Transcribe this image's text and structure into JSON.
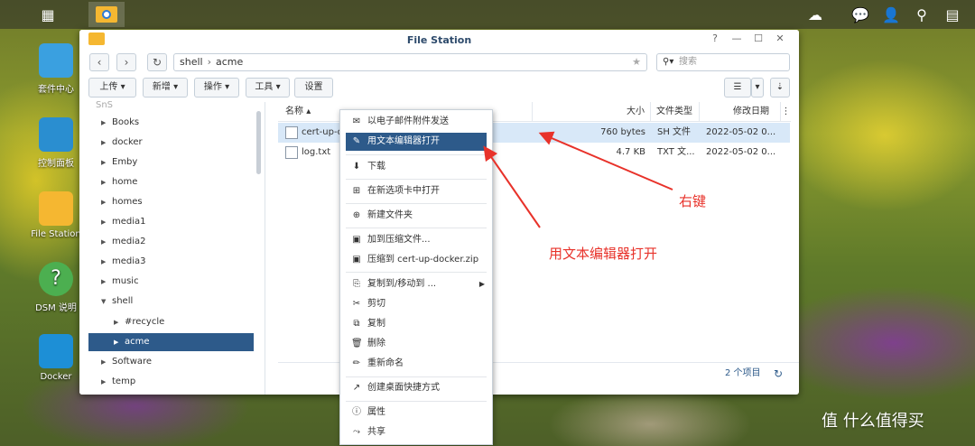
{
  "window": {
    "title": "File Station"
  },
  "desktop_icons": [
    {
      "label": "套件中心"
    },
    {
      "label": "控制面板"
    },
    {
      "label": "File Station"
    },
    {
      "label": "DSM 说明"
    },
    {
      "label": "Docker"
    }
  ],
  "path": {
    "segments": [
      "shell",
      "acme"
    ]
  },
  "search": {
    "placeholder": "搜索"
  },
  "toolbar": {
    "upload": "上传",
    "new": "新增",
    "action": "操作",
    "tools": "工具",
    "settings": "设置"
  },
  "tree": {
    "root": "SnS",
    "items": [
      {
        "label": "Books"
      },
      {
        "label": "docker"
      },
      {
        "label": "Emby"
      },
      {
        "label": "home"
      },
      {
        "label": "homes"
      },
      {
        "label": "media1"
      },
      {
        "label": "media2"
      },
      {
        "label": "media3"
      },
      {
        "label": "music"
      },
      {
        "label": "shell"
      },
      {
        "label": "#recycle"
      },
      {
        "label": "acme"
      },
      {
        "label": "Software"
      },
      {
        "label": "temp"
      }
    ]
  },
  "columns": {
    "name": "名称",
    "size": "大小",
    "type": "文件类型",
    "modified": "修改日期"
  },
  "files": [
    {
      "name": "cert-up-d",
      "size": "760 bytes",
      "type": "SH 文件",
      "modified": "2022-05-02 0..."
    },
    {
      "name": "log.txt",
      "size": "4.7 KB",
      "type": "TXT 文...",
      "modified": "2022-05-02 0..."
    }
  ],
  "footer": {
    "count": "2 个项目"
  },
  "context_menu": {
    "items": [
      {
        "label": "以电子邮件附件发送",
        "icon": "mail-icon"
      },
      {
        "label": "用文本编辑器打开",
        "icon": "edit-icon"
      },
      {
        "label": "下载",
        "icon": "download-icon"
      },
      {
        "label": "在新选项卡中打开",
        "icon": "new-tab-icon"
      },
      {
        "label": "新建文件夹",
        "icon": "new-folder-icon"
      },
      {
        "label": "加到压缩文件...",
        "icon": "archive-icon"
      },
      {
        "label": "压缩到 cert-up-docker.zip",
        "icon": "zip-icon"
      },
      {
        "label": "复制到/移动到 ...",
        "icon": "copy-move-icon"
      },
      {
        "label": "剪切",
        "icon": "cut-icon"
      },
      {
        "label": "复制",
        "icon": "copy-icon"
      },
      {
        "label": "删除",
        "icon": "delete-icon"
      },
      {
        "label": "重新命名",
        "icon": "rename-icon"
      },
      {
        "label": "创建桌面快捷方式",
        "icon": "shortcut-icon"
      },
      {
        "label": "属性",
        "icon": "info-icon"
      },
      {
        "label": "共享",
        "icon": "share-icon"
      }
    ]
  },
  "annotations": {
    "right_click": "右键",
    "open_with_editor": "用文本编辑器打开"
  },
  "watermark": "值 什么值得买",
  "colors": {
    "accent": "#2d5a8a",
    "annotation": "#e8322a"
  }
}
